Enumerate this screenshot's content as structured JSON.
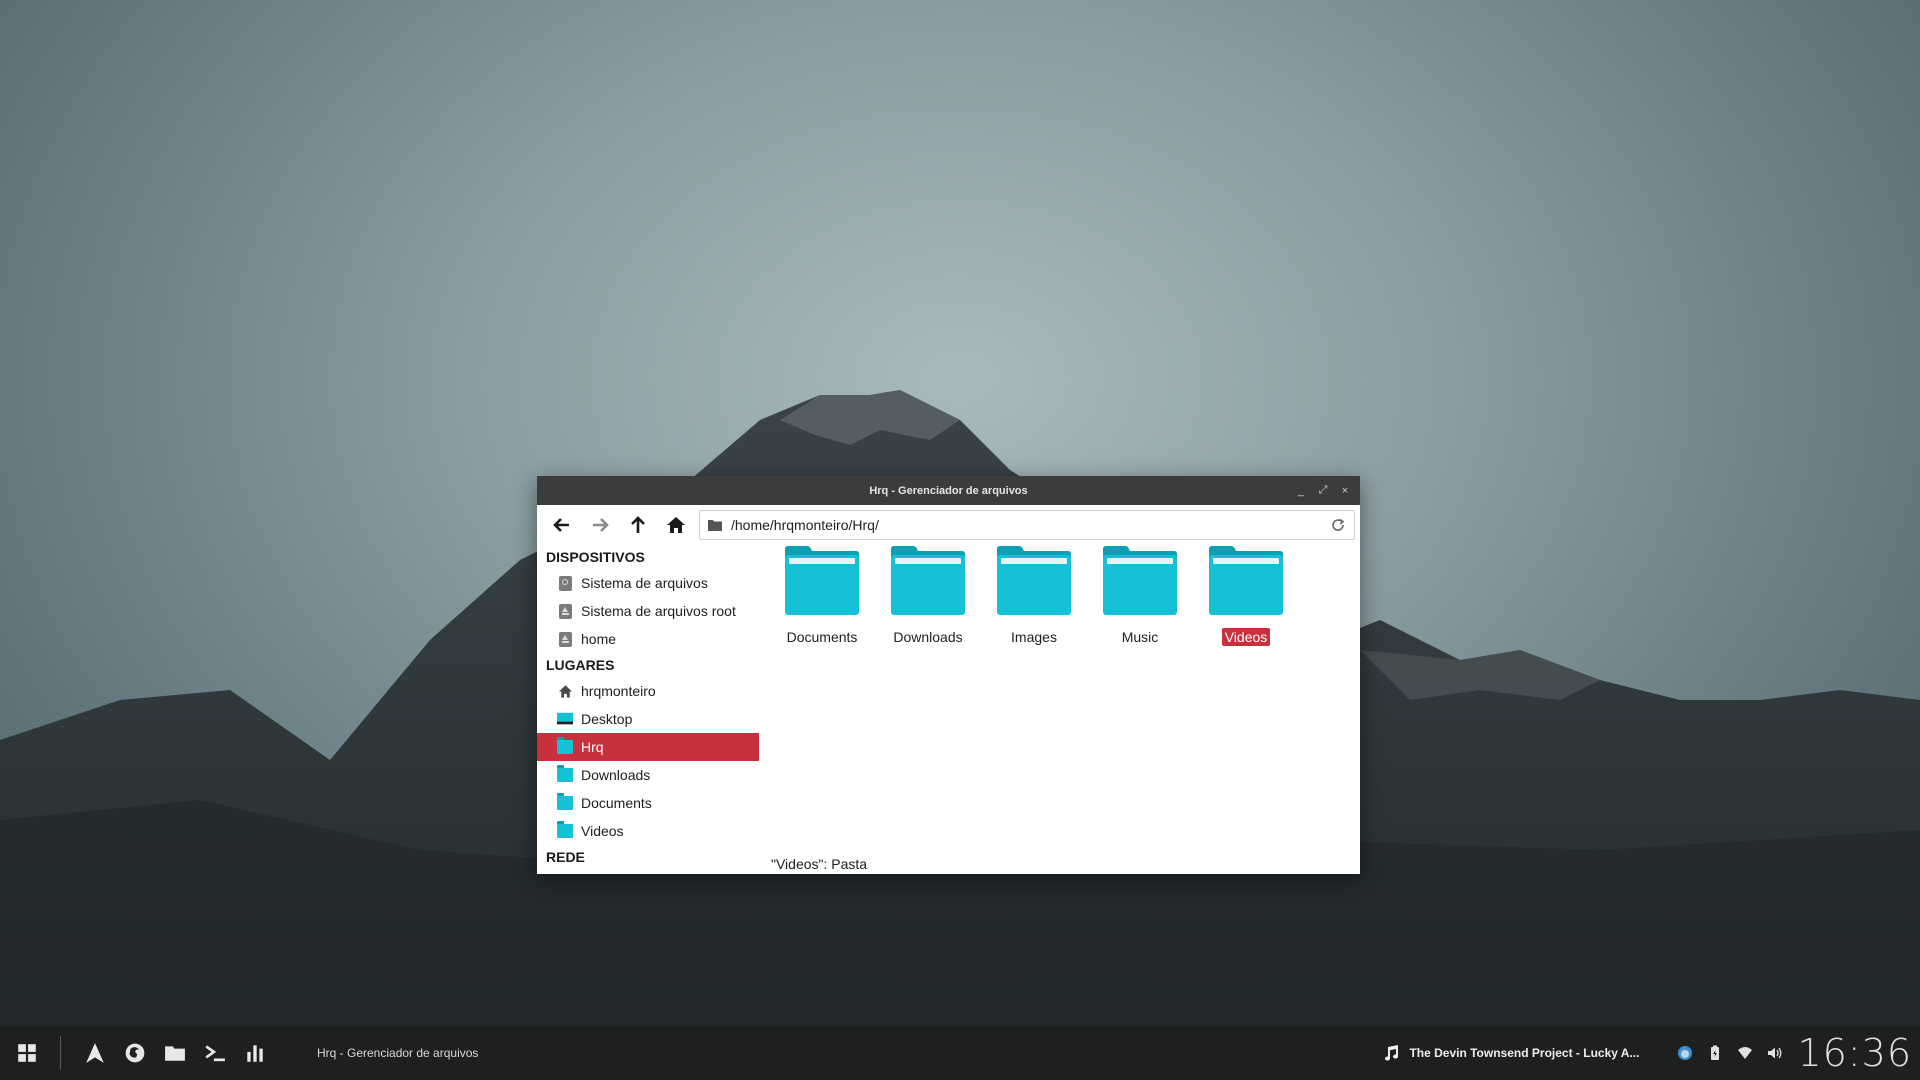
{
  "window": {
    "title": "Hrq - Gerenciador de arquivos",
    "controls": {
      "minimize": "_",
      "maximize": "⤢",
      "close": "×"
    }
  },
  "toolbar": {
    "path": "/home/hrqmonteiro/Hrq/"
  },
  "sidebar": {
    "devices_heading": "DISPOSITIVOS",
    "devices": [
      {
        "label": "Sistema de arquivos",
        "icon": "drive-icon"
      },
      {
        "label": "Sistema de arquivos root",
        "icon": "eject-icon"
      },
      {
        "label": "home",
        "icon": "eject-icon"
      }
    ],
    "places_heading": "LUGARES",
    "places": [
      {
        "label": "hrqmonteiro",
        "icon": "home-icon"
      },
      {
        "label": "Desktop",
        "icon": "desktop-icon"
      },
      {
        "label": "Hrq",
        "icon": "folder-icon",
        "active": true
      },
      {
        "label": "Downloads",
        "icon": "folder-icon"
      },
      {
        "label": "Documents",
        "icon": "folder-icon"
      },
      {
        "label": "Videos",
        "icon": "folder-icon"
      }
    ],
    "network_heading": "REDE"
  },
  "files": [
    {
      "name": "Documents"
    },
    {
      "name": "Downloads"
    },
    {
      "name": "Images"
    },
    {
      "name": "Music"
    },
    {
      "name": "Videos",
      "selected": true
    }
  ],
  "status": "\"Videos\": Pasta",
  "taskbar": {
    "task_title": "Hrq - Gerenciador de arquivos",
    "now_playing": "The Devin Townsend Project - Lucky A...",
    "clock": "16:36"
  },
  "colors": {
    "accent": "#c8303e",
    "folder": "#16c1d8",
    "titlebar": "#3b3c3c",
    "taskbar": "#1e2020"
  }
}
